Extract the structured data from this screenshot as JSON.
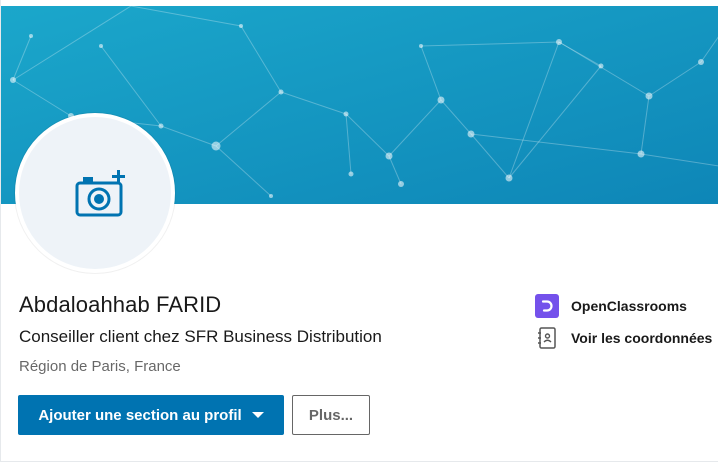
{
  "profile": {
    "name": "Abdaloahhab FARID",
    "headline": "Conseiller client chez SFR Business Distribution",
    "location": "Région de Paris, France"
  },
  "actions": {
    "add_section_label": "Ajouter une section au profil",
    "more_label": "Plus..."
  },
  "sidebar": {
    "company_label": "OpenClassrooms",
    "contact_label": "Voir les coordonnées"
  },
  "colors": {
    "banner_start": "#1aa0c6",
    "banner_end": "#0f87b8",
    "primary": "#0073b1",
    "company_logo": "#7451eb"
  },
  "icons": {
    "avatar": "camera-add-icon",
    "company": "openclassrooms-logo",
    "contact": "address-book-icon",
    "dropdown": "caret-down-icon"
  }
}
